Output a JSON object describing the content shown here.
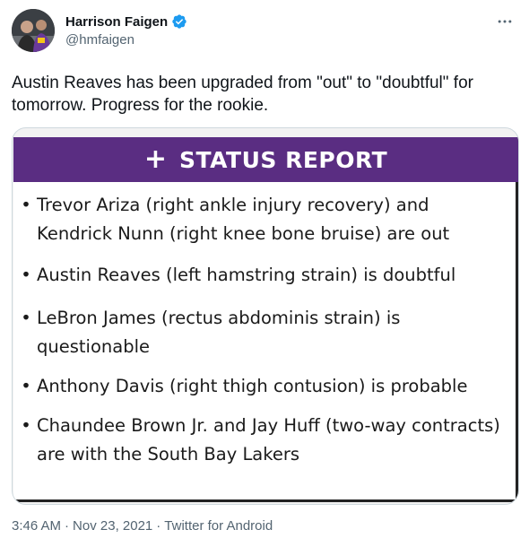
{
  "tweet": {
    "display_name": "Harrison Faigen",
    "handle": "@hmfaigen",
    "text": "Austin Reaves has been upgraded from \"out\" to \"doubtful\" for tomorrow. Progress for the rookie.",
    "more_icon": "more-horizontal-icon",
    "verified_icon": "verified-badge-icon"
  },
  "image": {
    "banner_icon": "plus-icon",
    "banner_plus": "+",
    "banner_title": "STATUS REPORT",
    "bullet": "•",
    "items": [
      "Trevor Ariza (right ankle injury recovery) and Kendrick Nunn (right knee bone bruise) are out",
      "Austin Reaves (left hamstring strain) is doubtful",
      "LeBron James (rectus abdominis strain) is questionable",
      "Anthony Davis (right thigh contusion) is probable",
      "Chaundee Brown Jr. and Jay Huff (two-way contracts) are with the South Bay Lakers"
    ]
  },
  "footer": {
    "time": "3:46 AM",
    "sep1": "·",
    "date": "Nov 23, 2021",
    "sep2": "·",
    "source": "Twitter for Android"
  },
  "colors": {
    "banner": "#5a2d82",
    "verified": "#1d9bf0",
    "secondary_text": "#536471"
  }
}
